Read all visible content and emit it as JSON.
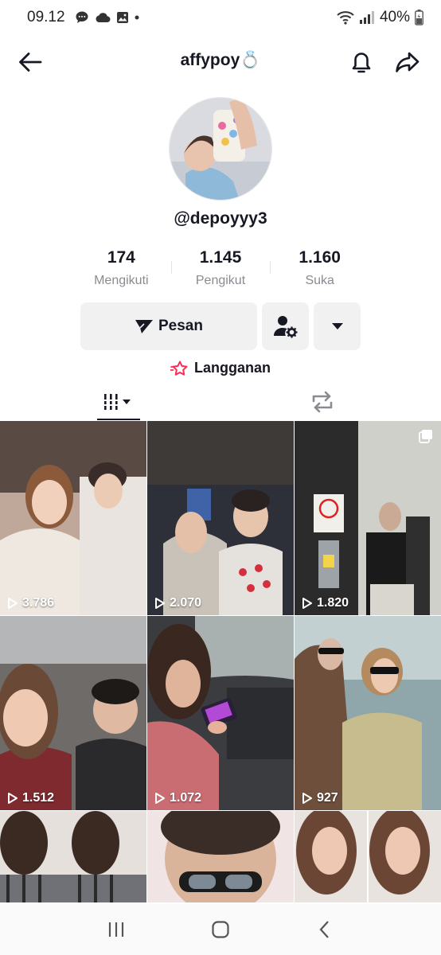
{
  "status_bar": {
    "time": "09.12",
    "battery": "40%"
  },
  "header": {
    "title": "affypoy💍"
  },
  "profile": {
    "handle": "@depoyyy3"
  },
  "stats": [
    {
      "value": "174",
      "label": "Mengikuti"
    },
    {
      "value": "1.145",
      "label": "Pengikut"
    },
    {
      "value": "1.160",
      "label": "Suka"
    }
  ],
  "actions": {
    "message_label": "Pesan"
  },
  "subscription": {
    "label": "Langganan"
  },
  "videos": [
    {
      "views": "3.786"
    },
    {
      "views": "2.070"
    },
    {
      "views": "1.820"
    },
    {
      "views": "1.512"
    },
    {
      "views": "1.072"
    },
    {
      "views": "927"
    }
  ],
  "colors": {
    "accent": "#fe2c55",
    "text": "#161823",
    "muted": "#8a8b91",
    "button_bg": "#f1f1f2"
  }
}
